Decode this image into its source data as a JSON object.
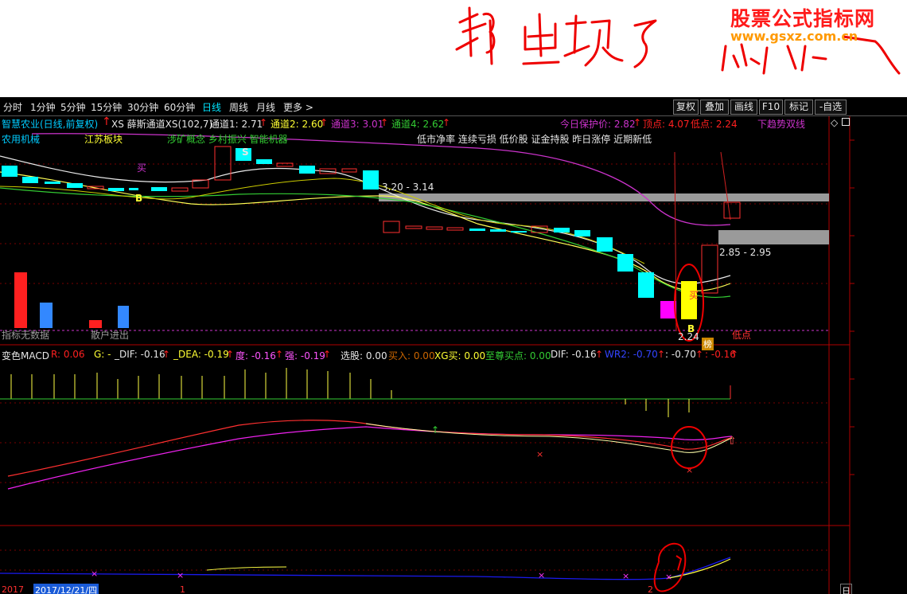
{
  "watermark": {
    "site_name": "股票公式指标网",
    "site_url": "www.gsxz.com.cn"
  },
  "handwritten_note": "都出现了",
  "menu": {
    "periods": [
      "分时",
      "1分钟",
      "5分钟",
      "15分钟",
      "30分钟",
      "60分钟",
      "日线",
      "周线",
      "月线",
      "更多 >"
    ],
    "active_period": "日线",
    "right_buttons": [
      "复权",
      "叠加",
      "画线",
      "F10",
      "标记",
      "-自选"
    ]
  },
  "main": {
    "stock": "智慧农业(日线,前复权)",
    "indicator_name": "XS 薛斯通道XS(102,7)",
    "ch1": "通道1: 2.71",
    "ch2": "通道2: 2.60",
    "ch3": "通道3: 3.01",
    "ch4": "通道4: 2.62",
    "protect": "今日保护价: 2.82",
    "top": "顶点: 4.07",
    "low": "低点: 2.24",
    "trend": "下趋势双线",
    "sectors": [
      "农用机械",
      "江苏板块",
      "涉矿概念 乡村振兴 智能机器"
    ],
    "tags": "低市净率 连续亏损 低价股 证金持股 昨日涨停 近期新低",
    "range1": "3.20 - 3.14",
    "range2": "2.85 - 2.95",
    "low_price": "2.24",
    "buy": "买",
    "b": "B",
    "s": "S",
    "low_point": "低点",
    "bang": "榜",
    "indicator_note": "指标无数据",
    "retail_label": "散户进出"
  },
  "macd": {
    "name": "变色MACD",
    "r": "R: 0.06",
    "g": "G: -",
    "dif": "_DIF: -0.16",
    "dea": "_DEA: -0.19",
    "du": "度: -0.16",
    "qiang": "强: -0.19",
    "xg": "选股: 0.00",
    "buy_in": "买入: 0.00",
    "xgbuy": "XG买: 0.00",
    "zz": "至尊买点: 0.00",
    "dif2": "DIF: -0.16",
    "wr2": "WR2: -0.70",
    "c1": ": -0.70",
    "c2": ": -0.16"
  },
  "dates": {
    "y1": "2017",
    "selected": "2017/12/21/四",
    "m1": "1",
    "m2": "2",
    "r": "日"
  },
  "colors": {
    "up": "#ff2020",
    "down": "#00ffff",
    "channel": "#ffffff",
    "purple": "#cc33cc",
    "yellow": "#ffff33",
    "green": "#33cc33",
    "red_hand": "#ee0000"
  }
}
